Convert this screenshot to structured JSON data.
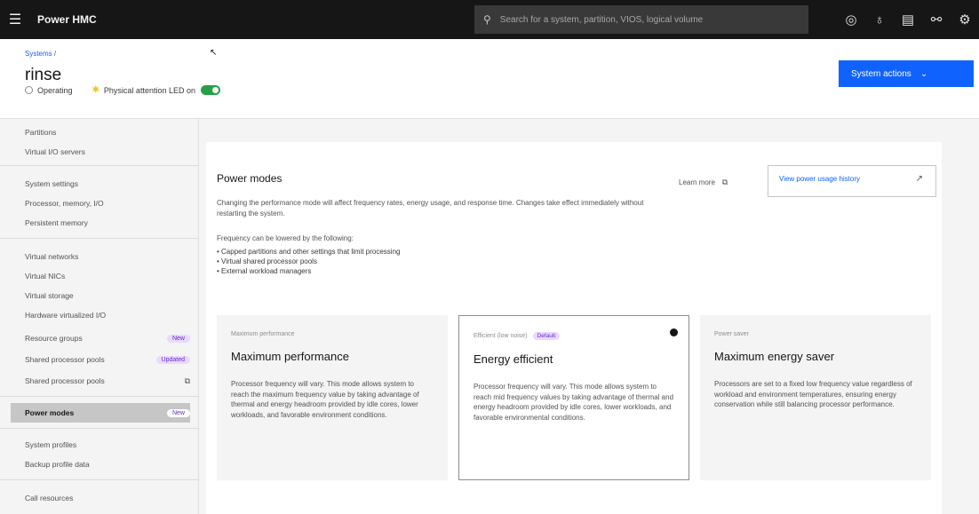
{
  "topbar": {
    "app_title": "Power HMC",
    "search_placeholder": "Search for a system, partition, VIOS, logical volume"
  },
  "header": {
    "breadcrumb": "Systems /",
    "title": "rinse",
    "status": "Operating",
    "attention": "Physical attention LED on",
    "actions_label": "System actions"
  },
  "sidebar": {
    "items": [
      {
        "label": "Partitions"
      },
      {
        "label": "Virtual I/O servers"
      },
      {
        "label": "System settings"
      },
      {
        "label": "Processor, memory, I/O"
      },
      {
        "label": "Persistent memory"
      },
      {
        "label": "Virtual networks"
      },
      {
        "label": "Virtual NICs"
      },
      {
        "label": "Virtual storage"
      },
      {
        "label": "Hardware virtualized I/O"
      },
      {
        "label": "Resource groups",
        "tag": "New"
      },
      {
        "label": "Shared processor pools",
        "tag": "Updated"
      },
      {
        "label": "Shared processor pools"
      },
      {
        "label": "Power modes",
        "tag": "New"
      },
      {
        "label": "System profiles"
      },
      {
        "label": "Backup profile data"
      },
      {
        "label": "Call resources"
      }
    ]
  },
  "main": {
    "section_title": "Power modes",
    "learn_more": "Learn more",
    "usage_button": "View power usage history",
    "description": "Changing the performance mode will affect frequency rates, energy usage, and response time. Changes take effect immediately without restarting the system.",
    "freq_intro": "Frequency can be lowered by the following:",
    "bullets": [
      "Capped partitions and other settings that limit processing",
      "Virtual shared processor pools",
      "External workload managers"
    ],
    "tiles": [
      {
        "kicker": "Maximum performance",
        "title": "Maximum performance",
        "desc": "Processor frequency will vary. This mode allows system to reach the maximum frequency value by taking advantage of thermal and energy headroom provided by idle cores, lower workloads, and favorable environment conditions."
      },
      {
        "kicker": "Efficient (low noise)",
        "tag": "Default",
        "title": "Energy efficient",
        "desc": "Processor frequency will vary. This mode allows system to reach mid frequency values by taking advantage of thermal and energy headroom provided by idle cores, lower workloads, and favorable environmental conditions.",
        "selected": true
      },
      {
        "kicker": "Power saver",
        "title": "Maximum energy saver",
        "desc": "Processors are set to a fixed low frequency value regardless of workload and environment temperatures, ensuring energy conservation while still balancing processor performance."
      }
    ]
  }
}
